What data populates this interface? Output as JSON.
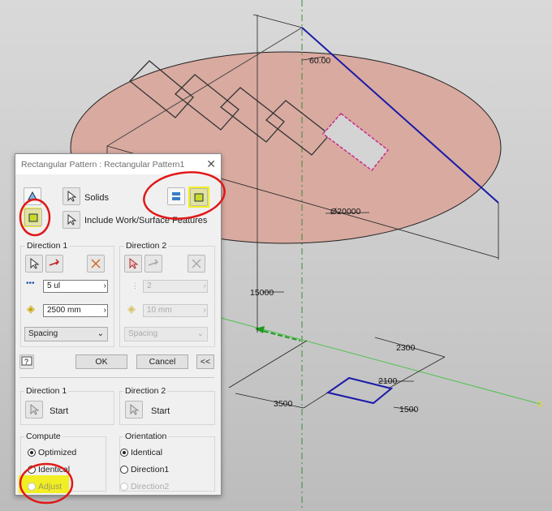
{
  "canvas": {
    "dim_angle": "60.00",
    "dim_diameter": "Ø20000",
    "dim_height": "15000",
    "dim_2300": "2300",
    "dim_2100": "2100",
    "dim_3500": "3500",
    "dim_1500": "1500"
  },
  "dialog": {
    "title": "Rectangular Pattern : Rectangular Pattern1",
    "solids_label": "Solids",
    "include_label": "Include Work/Surface Features",
    "direction1": {
      "title": "Direction 1",
      "count": "5 ul",
      "spacing": "2500 mm",
      "method": "Spacing"
    },
    "direction2": {
      "title": "Direction 2",
      "count": "2",
      "spacing": "10 mm",
      "method": "Spacing"
    },
    "ok_label": "OK",
    "cancel_label": "Cancel",
    "more_label": "<<",
    "start1": {
      "title": "Direction 1",
      "label": "Start"
    },
    "start2": {
      "title": "Direction 2",
      "label": "Start"
    },
    "compute": {
      "title": "Compute",
      "options": [
        "Optimized",
        "Identical",
        "Adjust"
      ],
      "selected": "Optimized"
    },
    "orientation": {
      "title": "Orientation",
      "options": [
        "Identical",
        "Direction1",
        "Direction2"
      ],
      "selected": "Identical"
    }
  },
  "annotation_colors": {
    "highlight": "#f1ee24",
    "circle": "#e01818"
  }
}
